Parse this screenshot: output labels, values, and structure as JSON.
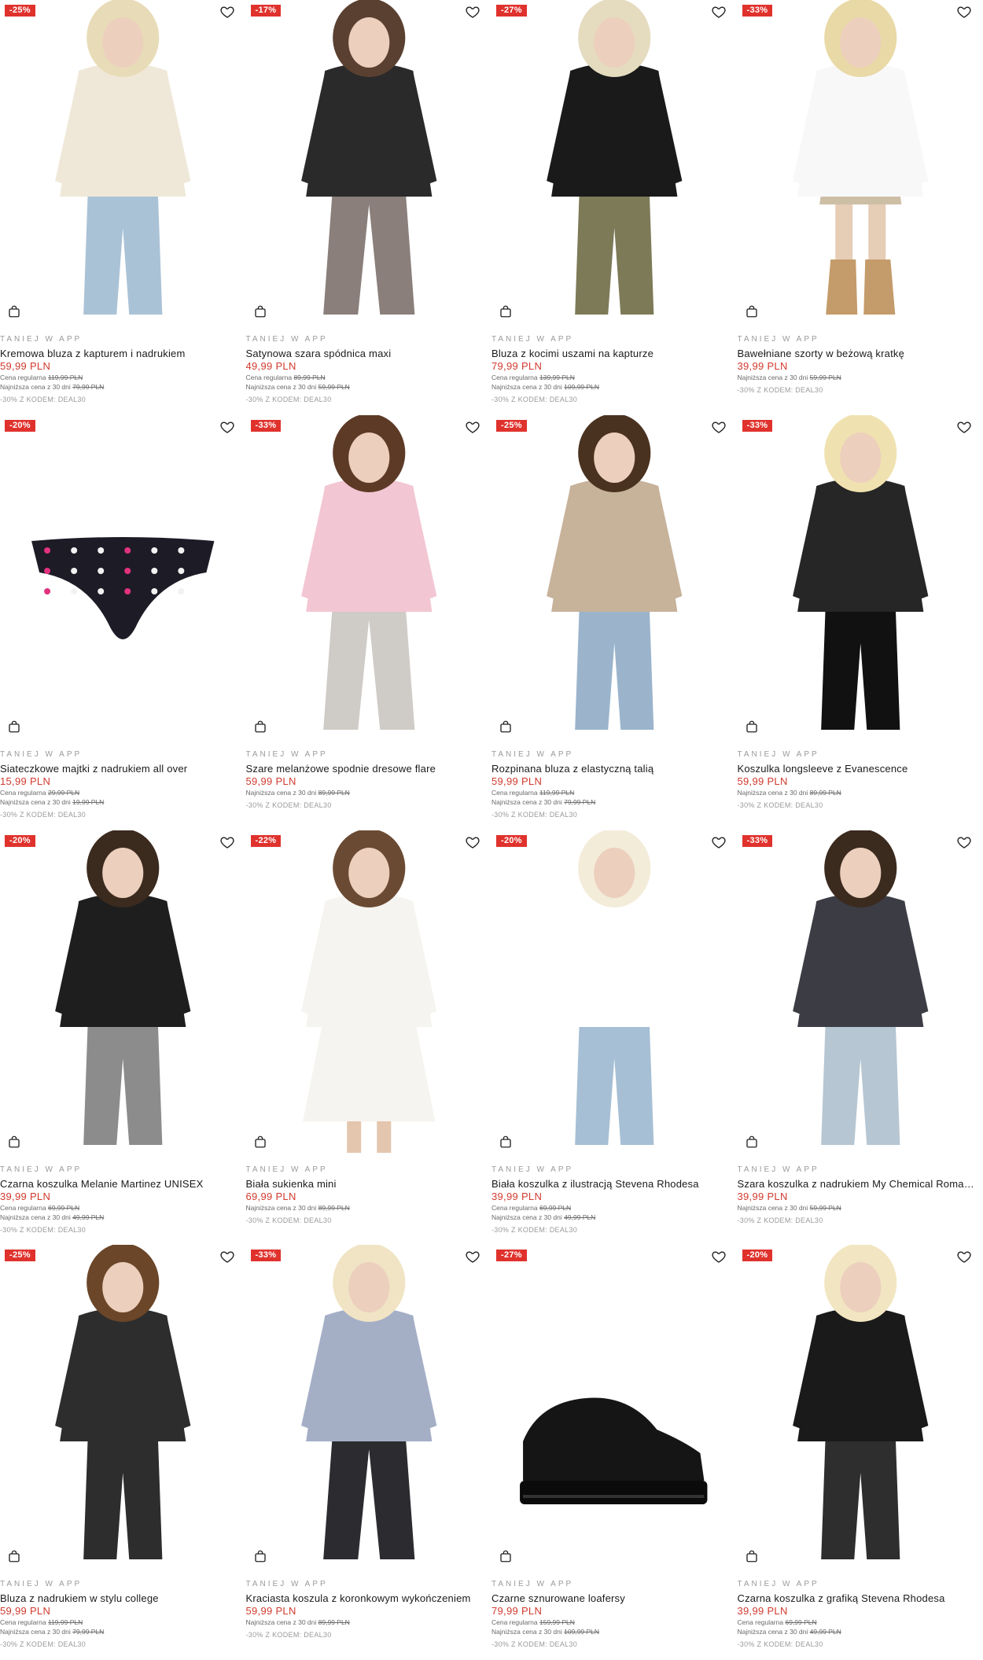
{
  "colors": {
    "badge": "#e0322d",
    "price": "#d13a2e",
    "muted": "#9a9a9a"
  },
  "icons": {
    "wishlist": "heart-icon",
    "cart": "shopping-bag-icon"
  },
  "products": [
    {
      "discount": "-25%",
      "tag": "TANIEJ W APP",
      "name": "Kremowa bluza z kapturem i nadrukiem",
      "price": "59,99 PLN",
      "regular_label": "Cena regularna",
      "regular_price": "119,99 PLN",
      "lowest_label": "Najniższa cena z 30 dni",
      "lowest_price": "79,99 PLN",
      "code": "-30% Z KODEM: DEAL30"
    },
    {
      "discount": "-17%",
      "tag": "TANIEJ W APP",
      "name": "Satynowa szara spódnica maxi",
      "price": "49,99 PLN",
      "regular_label": "Cena regularna",
      "regular_price": "89,99 PLN",
      "lowest_label": "Najniższa cena z 30 dni",
      "lowest_price": "59,99 PLN",
      "code": "-30% Z KODEM: DEAL30"
    },
    {
      "discount": "-27%",
      "tag": "TANIEJ W APP",
      "name": "Bluza z kocimi uszami na kapturze",
      "price": "79,99 PLN",
      "regular_label": "Cena regularna",
      "regular_price": "139,99 PLN",
      "lowest_label": "Najniższa cena z 30 dni",
      "lowest_price": "109,99 PLN",
      "code": "-30% Z KODEM: DEAL30"
    },
    {
      "discount": "-33%",
      "tag": "TANIEJ W APP",
      "name": "Bawełniane szorty w beżową kratkę",
      "price": "39,99 PLN",
      "regular_label": "",
      "regular_price": "",
      "lowest_label": "Najniższa cena z 30 dni",
      "lowest_price": "59,99 PLN",
      "code": "-30% Z KODEM: DEAL30"
    },
    {
      "discount": "-20%",
      "tag": "TANIEJ W APP",
      "name": "Siateczkowe majtki z nadrukiem all over",
      "price": "15,99 PLN",
      "regular_label": "Cena regularna",
      "regular_price": "29,99 PLN",
      "lowest_label": "Najniższa cena z 30 dni",
      "lowest_price": "19,99 PLN",
      "code": "-30% Z KODEM: DEAL30"
    },
    {
      "discount": "-33%",
      "tag": "TANIEJ W APP",
      "name": "Szare melanżowe spodnie dresowe flare",
      "price": "59,99 PLN",
      "regular_label": "",
      "regular_price": "",
      "lowest_label": "Najniższa cena z 30 dni",
      "lowest_price": "89,99 PLN",
      "code": "-30% Z KODEM: DEAL30"
    },
    {
      "discount": "-25%",
      "tag": "TANIEJ W APP",
      "name": "Rozpinana bluza z elastyczną talią",
      "price": "59,99 PLN",
      "regular_label": "Cena regularna",
      "regular_price": "119,99 PLN",
      "lowest_label": "Najniższa cena z 30 dni",
      "lowest_price": "79,99 PLN",
      "code": "-30% Z KODEM: DEAL30"
    },
    {
      "discount": "-33%",
      "tag": "TANIEJ W APP",
      "name": "Koszulka longsleeve z Evanescence",
      "price": "59,99 PLN",
      "regular_label": "",
      "regular_price": "",
      "lowest_label": "Najniższa cena z 30 dni",
      "lowest_price": "89,99 PLN",
      "code": "-30% Z KODEM: DEAL30"
    },
    {
      "discount": "-20%",
      "tag": "TANIEJ W APP",
      "name": "Czarna koszulka Melanie Martinez UNISEX",
      "price": "39,99 PLN",
      "regular_label": "Cena regularna",
      "regular_price": "69,99 PLN",
      "lowest_label": "Najniższa cena z 30 dni",
      "lowest_price": "49,99 PLN",
      "code": "-30% Z KODEM: DEAL30"
    },
    {
      "discount": "-22%",
      "tag": "TANIEJ W APP",
      "name": "Biała sukienka mini",
      "price": "69,99 PLN",
      "regular_label": "",
      "regular_price": "",
      "lowest_label": "Najniższa cena z 30 dni",
      "lowest_price": "89,99 PLN",
      "code": "-30% Z KODEM: DEAL30"
    },
    {
      "discount": "-20%",
      "tag": "TANIEJ W APP",
      "name": "Biała koszulka z ilustracją Stevena Rhodesa",
      "price": "39,99 PLN",
      "regular_label": "Cena regularna",
      "regular_price": "69,99 PLN",
      "lowest_label": "Najniższa cena z 30 dni",
      "lowest_price": "49,99 PLN",
      "code": "-30% Z KODEM: DEAL30"
    },
    {
      "discount": "-33%",
      "tag": "TANIEJ W APP",
      "name": "Szara koszulka z nadrukiem My Chemical Romance",
      "price": "39,99 PLN",
      "regular_label": "",
      "regular_price": "",
      "lowest_label": "Najniższa cena z 30 dni",
      "lowest_price": "59,99 PLN",
      "code": "-30% Z KODEM: DEAL30"
    },
    {
      "discount": "-25%",
      "tag": "TANIEJ W APP",
      "name": "Bluza z nadrukiem w stylu college",
      "price": "59,99 PLN",
      "regular_label": "Cena regularna",
      "regular_price": "119,99 PLN",
      "lowest_label": "Najniższa cena z 30 dni",
      "lowest_price": "79,99 PLN",
      "code": "-30% Z KODEM: DEAL30"
    },
    {
      "discount": "-33%",
      "tag": "TANIEJ W APP",
      "name": "Kraciasta koszula z koronkowym wykończeniem",
      "price": "59,99 PLN",
      "regular_label": "",
      "regular_price": "",
      "lowest_label": "Najniższa cena z 30 dni",
      "lowest_price": "89,99 PLN",
      "code": "-30% Z KODEM: DEAL30"
    },
    {
      "discount": "-27%",
      "tag": "TANIEJ W APP",
      "name": "Czarne sznurowane loafersy",
      "price": "79,99 PLN",
      "regular_label": "Cena regularna",
      "regular_price": "159,99 PLN",
      "lowest_label": "Najniższa cena z 30 dni",
      "lowest_price": "109,99 PLN",
      "code": "-30% Z KODEM: DEAL30"
    },
    {
      "discount": "-20%",
      "tag": "TANIEJ W APP",
      "name": "Czarna koszulka z grafiką Stevena Rhodesa",
      "price": "39,99 PLN",
      "regular_label": "Cena regularna",
      "regular_price": "69,99 PLN",
      "lowest_label": "Najniższa cena z 30 dni",
      "lowest_price": "49,99 PLN",
      "code": "-30% Z KODEM: DEAL30"
    }
  ]
}
